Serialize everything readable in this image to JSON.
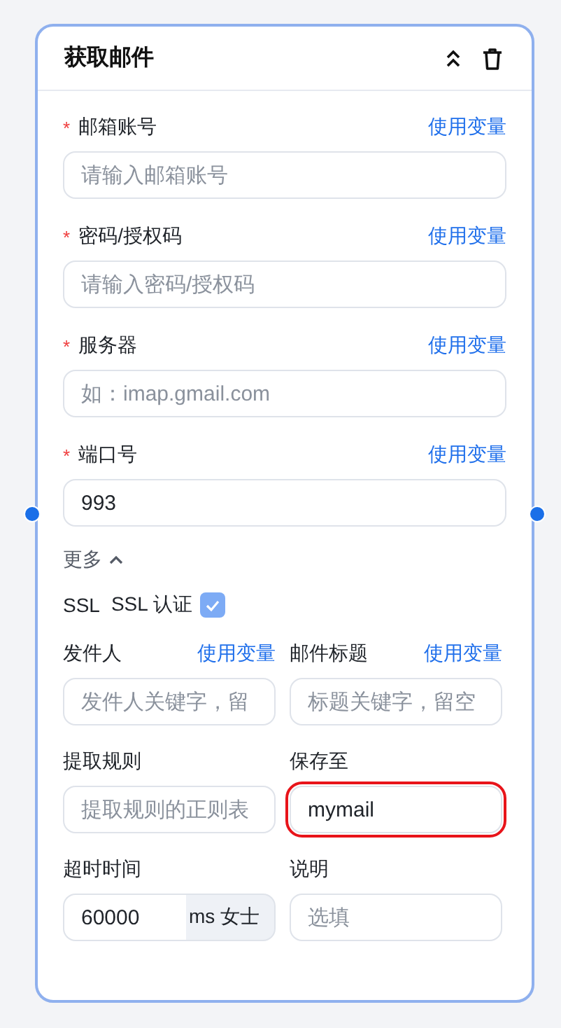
{
  "title": "获取邮件",
  "fields": [
    {
      "label": "邮箱账号",
      "marker": "*",
      "link": "使用变量",
      "placeholder": "请输入邮箱账号"
    },
    {
      "label": "密码/授权码",
      "marker": "*",
      "link": "使用变量",
      "placeholder": "请输入密码/授权码"
    },
    {
      "label": "服务器",
      "marker": "*",
      "link": "使用变量",
      "placeholder": "如：imap.gmail.com"
    },
    {
      "label": "端口号",
      "marker": "*",
      "link": "使用变量",
      "value": "993"
    }
  ],
  "more": {
    "label": "更多",
    "expanded": true
  },
  "ssl": {
    "label": "SSL",
    "text": "SSL 认证",
    "checked": true
  },
  "grid_fields": [
    {
      "label": "发件人",
      "link": "使用变量",
      "placeholder": "发件人关键字，留"
    },
    {
      "label": "邮件标题",
      "link": "使用变量",
      "placeholder": "标题关键字，留空"
    },
    {
      "label": "提取规则",
      "placeholder": "提取规则的正则表"
    },
    {
      "label": "保存至",
      "value": "mymail",
      "highlighted": true
    },
    {
      "label": "超时时间",
      "value": "60000",
      "suffix": "ms 女士"
    },
    {
      "label": "说明",
      "placeholder": "选填"
    }
  ]
}
